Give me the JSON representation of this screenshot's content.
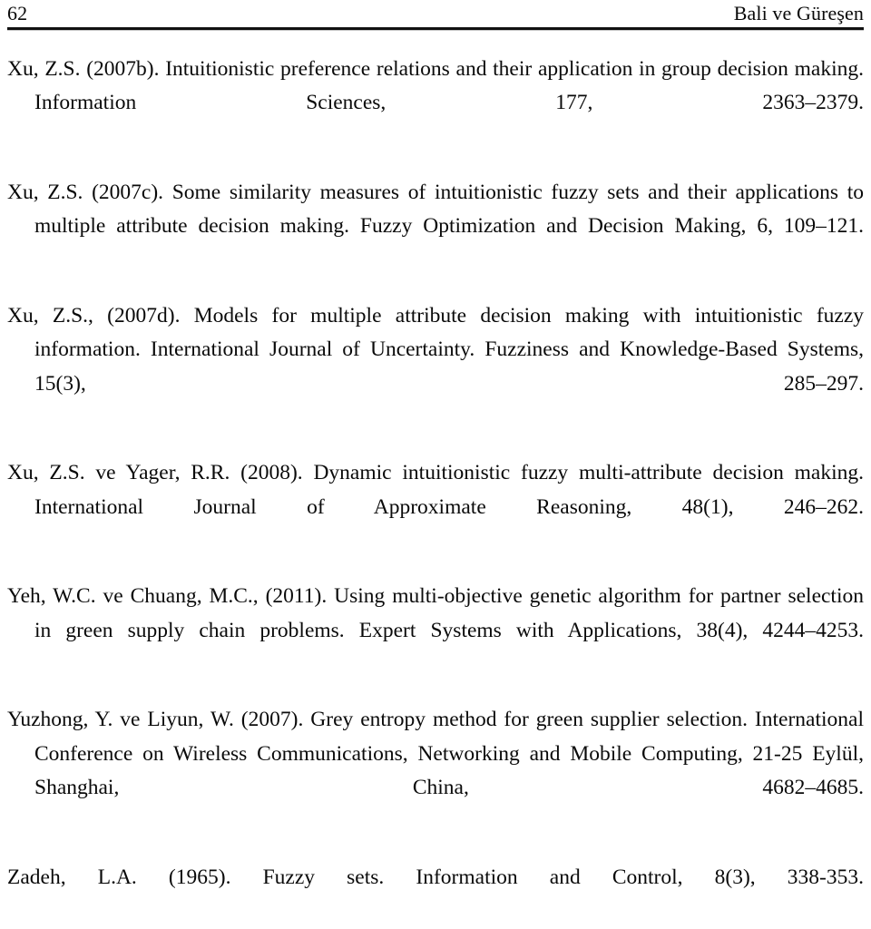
{
  "header": {
    "folio": "62",
    "running_title": "Bali ve Güreşen"
  },
  "references": [
    {
      "id": "xu-2007b",
      "text": "Xu, Z.S. (2007b). Intuitionistic preference relations and their application in group decision making. Information Sciences, 177, 2363–2379."
    },
    {
      "id": "xu-2007c",
      "text": "Xu, Z.S. (2007c). Some similarity measures of intuitionistic fuzzy sets and their applications to multiple attribute decision making. Fuzzy Optimization and Decision Making, 6, 109–121."
    },
    {
      "id": "xu-2007d",
      "text": "Xu, Z.S., (2007d). Models for multiple attribute decision making with intuitionistic fuzzy information. International Journal of Uncertainty. Fuzziness and Knowledge-Based Systems, 15(3), 285–297."
    },
    {
      "id": "xu-yager-2008",
      "text": "Xu, Z.S. ve Yager, R.R. (2008). Dynamic intuitionistic fuzzy multi-attribute decision making. International Journal of Approximate Reasoning, 48(1), 246–262."
    },
    {
      "id": "yeh-chuang-2011",
      "text": "Yeh, W.C. ve Chuang, M.C., (2011). Using multi-objective genetic algorithm for partner selection in green supply chain problems. Expert Systems with Applications, 38(4), 4244–4253."
    },
    {
      "id": "yuzhong-liyun-2007",
      "text": "Yuzhong, Y. ve Liyun, W. (2007). Grey entropy method for green supplier selection. International Conference on Wireless Communications, Networking and Mobile Computing, 21-25 Eylül, Shanghai, China, 4682–4685."
    },
    {
      "id": "zadeh-1965",
      "text": "Zadeh, L.A. (1965). Fuzzy sets. Information and Control, 8(3), 338-353."
    }
  ]
}
